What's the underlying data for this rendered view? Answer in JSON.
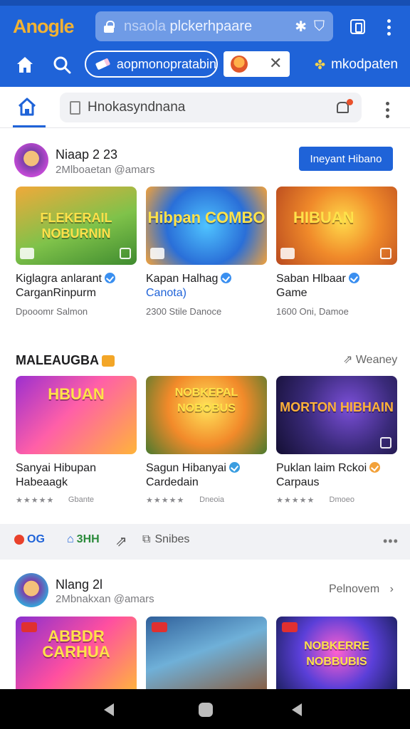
{
  "browser": {
    "logo_text": "Anogle",
    "url_dim": "nsaola",
    "url_text": "plckerhpaare",
    "chip_app_label": "aopmonopratabin",
    "shortcut_label": "mkodpaten"
  },
  "page_header": {
    "search_text": "Hnokasyndnana"
  },
  "channel1": {
    "name": "Niaap 2 23",
    "subscribers": "2Mlboaetan @amars",
    "follow_label": "Ineyant Hibano"
  },
  "row1": [
    {
      "thumb_text": "FLEKERAIL NOBURNIN",
      "title_line1": "Kiglagra anlarant",
      "title_line2": "CarganRinpurm",
      "meta": "Dpooomr Salmon",
      "verified": true
    },
    {
      "thumb_text": "Hibpan COMBO",
      "title_line1": "Kapan Halhag",
      "title_line2": "Canota)",
      "meta": "2300 Stile Danoce",
      "verified": true
    },
    {
      "thumb_text": "HIBUAN",
      "title_line1": "Saban Hlbaar",
      "title_line2": "Game",
      "meta": "1600 Oni, Damoe",
      "verified": true
    }
  ],
  "section2": {
    "title": "MALEAUGBA",
    "see_more": "Weaney"
  },
  "row2": [
    {
      "thumb_text": "HBUAN",
      "title_line1": "Sanyai Hibupan",
      "title_line2": "Habeaagk",
      "stars": "★★★★★",
      "meta": "Gbante"
    },
    {
      "thumb_text": "NOBKEPAL NOBOBUS",
      "title_line1": "Sagun Hibanyai",
      "title_line2": "Cardedain",
      "stars": "★★★★★",
      "meta": "Dneoia"
    },
    {
      "thumb_text": "MORTON HIBHAIN",
      "title_line1": "Puklan laim Rckoi",
      "title_line2": "Carpaus",
      "stars": "★★★★★",
      "meta": "Dmoeo"
    }
  ],
  "actions": {
    "item1": "OG",
    "item2": "3HH",
    "item4": "Snibes"
  },
  "channel2": {
    "name": "Nlang 2l",
    "subscribers": "2Mbnakxan @amars",
    "see_more": "Pelnovem"
  },
  "row3": [
    {
      "thumb_text": "ABBDR CARHUA"
    },
    {
      "thumb_text": ""
    },
    {
      "thumb_text": "NOBKERRE NOBBUBIS"
    }
  ],
  "colors": {
    "brand_blue": "#1f63d8",
    "nav_black": "#000000"
  }
}
